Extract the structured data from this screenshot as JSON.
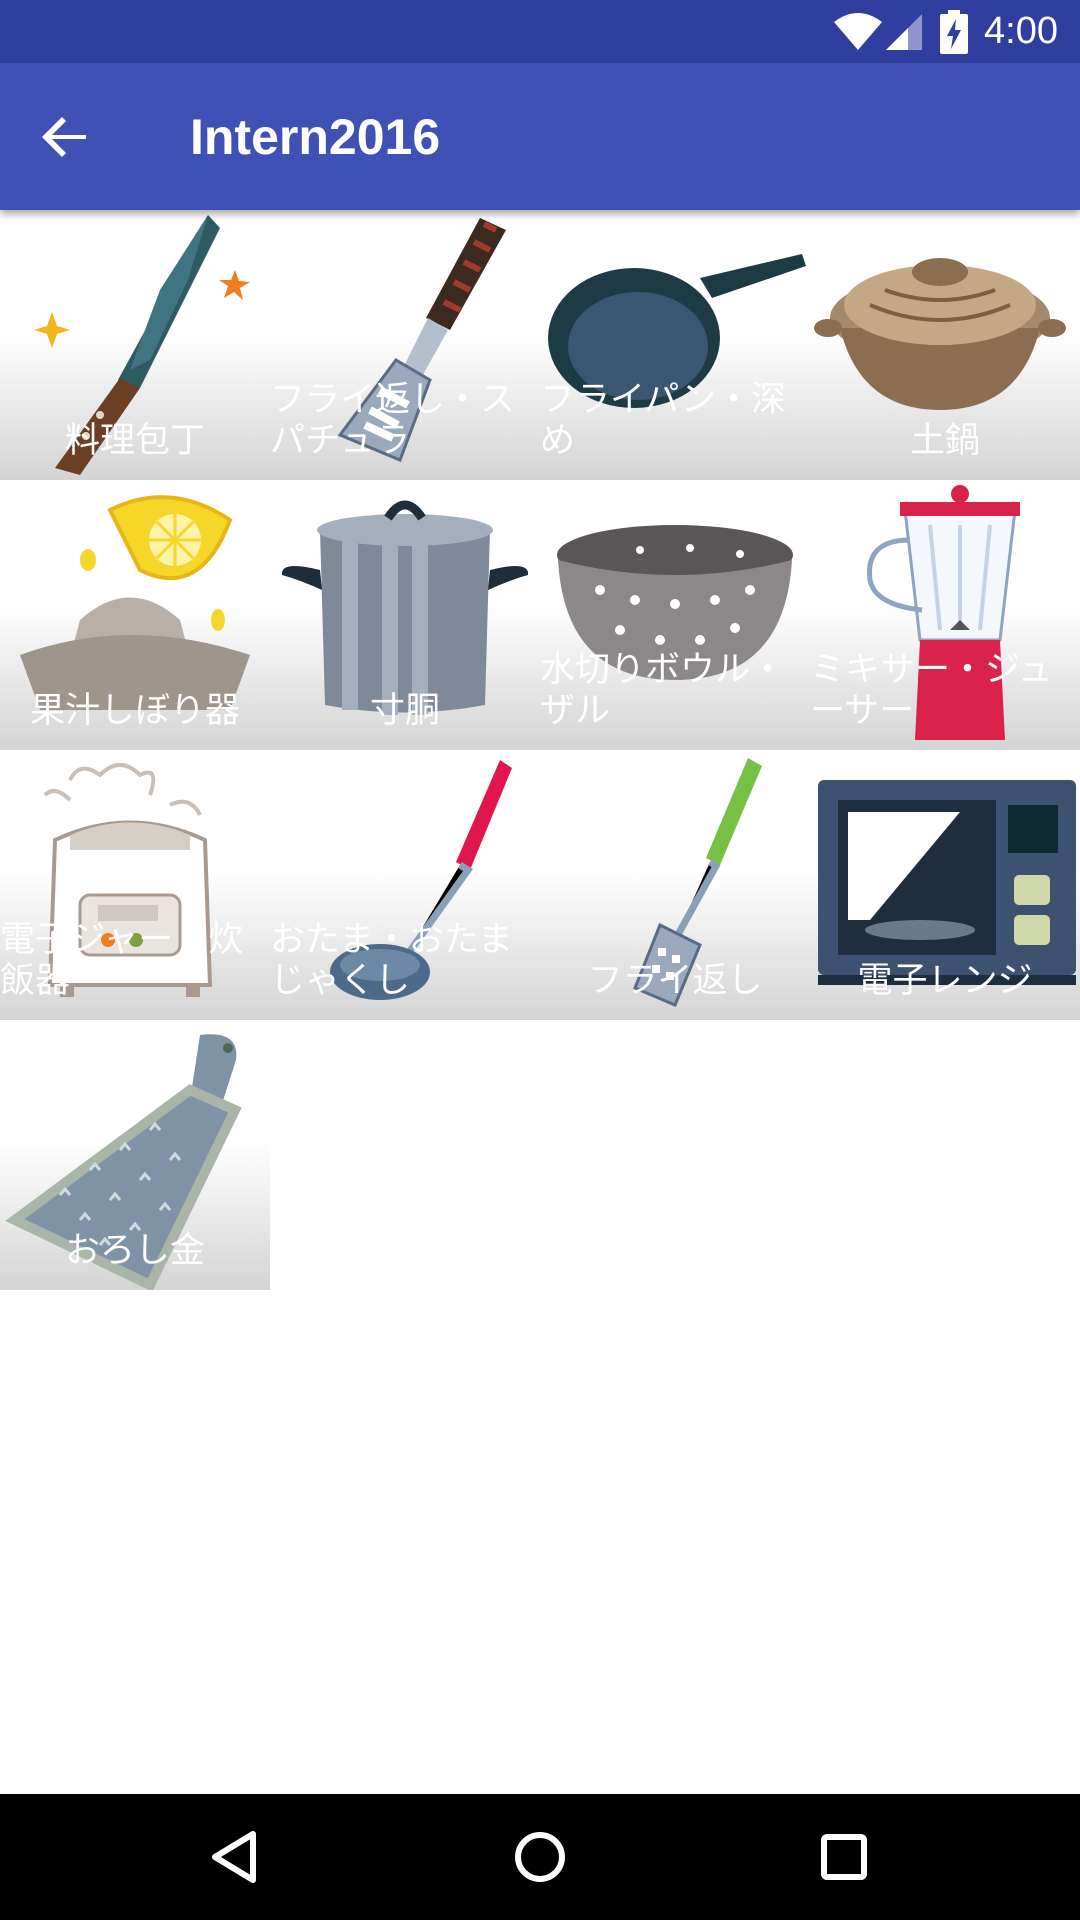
{
  "status_bar": {
    "time": "4:00",
    "icons": [
      "wifi-icon",
      "signal-icon",
      "battery-charging-icon"
    ]
  },
  "app_bar": {
    "title": "Intern2016",
    "back_icon": "arrow-back-icon"
  },
  "items": [
    {
      "label": "料理包丁",
      "icon": "kitchen-knife-icon"
    },
    {
      "label": "フライ返し・スパチュラ",
      "icon": "turner-spatula-icon"
    },
    {
      "label": "フライパン・深め",
      "icon": "frying-pan-icon"
    },
    {
      "label": "土鍋",
      "icon": "clay-pot-icon"
    },
    {
      "label": "果汁しぼり器",
      "icon": "juicer-icon"
    },
    {
      "label": "寸胴",
      "icon": "stock-pot-icon"
    },
    {
      "label": "水切りボウル・ザル",
      "icon": "colander-icon"
    },
    {
      "label": "ミキサー・ジューサー",
      "icon": "blender-icon"
    },
    {
      "label": "電子ジャー・炊飯器",
      "icon": "rice-cooker-icon"
    },
    {
      "label": "おたま・おたまじゃくし",
      "icon": "ladle-icon"
    },
    {
      "label": "フライ返し",
      "icon": "slotted-turner-icon"
    },
    {
      "label": "電子レンジ",
      "icon": "microwave-icon"
    },
    {
      "label": "おろし金",
      "icon": "grater-icon"
    }
  ],
  "nav_bar": {
    "icons": [
      "back-triangle-icon",
      "home-circle-icon",
      "recents-square-icon"
    ]
  },
  "colors": {
    "status_bar": "#303F9F",
    "app_bar": "#3F51B5",
    "nav_bar": "#000000"
  }
}
